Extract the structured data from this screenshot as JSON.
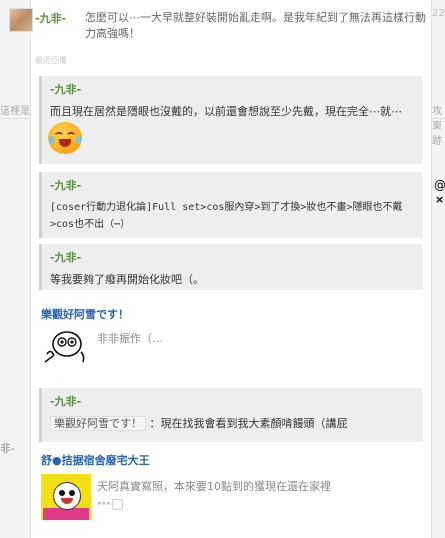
{
  "background": {
    "left_fragment_1": "這裡是今",
    "left_fragment_2": "非-",
    "right_fragment_1": "攻東跡",
    "right_fragment_2": "@",
    "right_close": "×",
    "top_right_digit": "22"
  },
  "top_comment": {
    "author": "-九非-",
    "text": "怎麼可以⋯一大早就整好裝開始亂走啊。是我年紀到了無法再這樣行動力高強嗎！",
    "faint_label": "最近回覆"
  },
  "quotes": [
    {
      "author": "-九非-",
      "text": "而且現在居然是隱眼也沒戴的，以前還會想說至少先戴，現在完全⋯就⋯",
      "has_emoji": true,
      "emoji_icon": "laughing-crying-face-icon"
    },
    {
      "author": "-九非-",
      "text_mono": "[coser行動力退化論]Full set>cos服內穿>到了才換>妝也不畫>隱眼也不戴>cos也不出（⋯）"
    },
    {
      "author": "-九非-",
      "text": "等我要夠了癈再開始化妝吧（。"
    }
  ],
  "post_1": {
    "author": "樂觀好阿雪です！",
    "reply_text": "非非振作（…"
  },
  "quote_4": {
    "author": "-九非-",
    "mention": "樂觀好阿雪です！",
    "text": "：現在找我會看到我大素顏啃饅頭（講屁"
  },
  "post_2": {
    "author": "舒●拮据宿舍廢宅大王",
    "text": "天阿真實寫照，本來要10點到的獲現在還在家裡",
    "faded_text": "⋯▢"
  }
}
